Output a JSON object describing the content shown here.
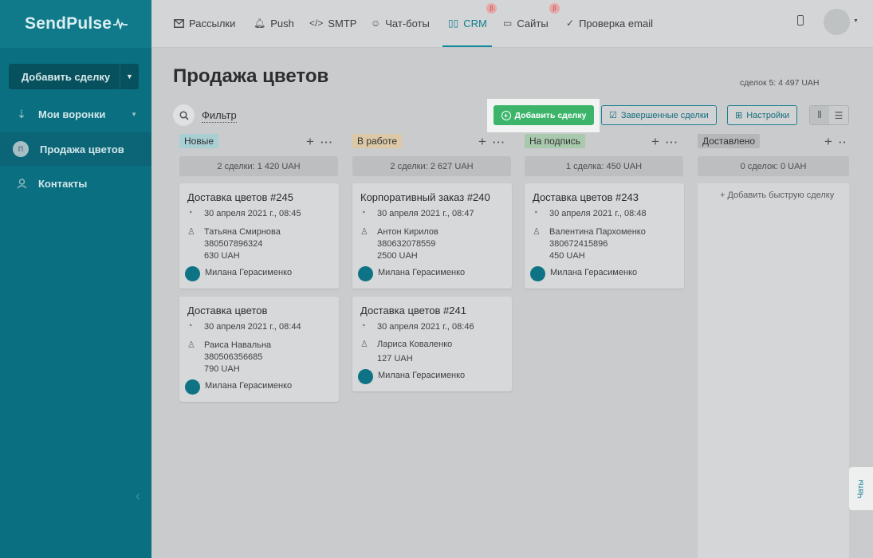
{
  "app": {
    "logo": "SendPulse"
  },
  "sidebar": {
    "add_deal": "Добавить сделку",
    "items": [
      {
        "label": "Мои воронки",
        "icon": "funnel-icon"
      },
      {
        "label": "Продажа цветов",
        "icon": "avatar",
        "initial": "П"
      },
      {
        "label": "Контакты",
        "icon": "contacts-icon"
      }
    ]
  },
  "topnav": {
    "items": [
      {
        "label": "Рассылки",
        "icon": "mail-icon"
      },
      {
        "label": "Push",
        "icon": "bell-icon"
      },
      {
        "label": "SMTP",
        "icon": "code-icon"
      },
      {
        "label": "Чат-боты",
        "icon": "chatbot-icon"
      },
      {
        "label": "CRM",
        "icon": "crm-icon",
        "beta": "β"
      },
      {
        "label": "Сайты",
        "icon": "site-icon",
        "beta": "β"
      },
      {
        "label": "Проверка email",
        "icon": "check-icon"
      }
    ]
  },
  "main": {
    "title": "Продажа цветов",
    "total": "сделок 5: 4 497 UAH",
    "filter": "Фильтр",
    "add_deal_button": "Добавить сделку",
    "completed_button": "Завершенные сделки",
    "settings_button": "Настройки"
  },
  "columns": [
    {
      "name": "Новые",
      "color": "#a8cfd3",
      "summary": "2 сделки: 1 420 UAH"
    },
    {
      "name": "В работе",
      "color": "#dcc8a6",
      "summary": "2 сделки: 2 627 UAH"
    },
    {
      "name": "На подпись",
      "color": "#a9c9ad",
      "summary": "1 сделка: 450 UAH"
    },
    {
      "name": "Доставлено",
      "color": "#b5b7b8",
      "summary": "0 сделок: 0 UAH",
      "quick_add": "Добавить быструю сделку"
    }
  ],
  "cards": [
    {
      "title": "Доставка цветов #245",
      "date": "30 апреля 2021 г., 08:45",
      "contact": "Татьяна Смирнова",
      "phone": "380507896324",
      "amount": "630 UAH",
      "manager": "Милана Герасименко"
    },
    {
      "title": "Доставка цветов",
      "date": "30 апреля 2021 г., 08:44",
      "contact": "Раиса Навальна",
      "phone": "380506356685",
      "amount": "790 UAH",
      "manager": "Милана Герасименко"
    },
    {
      "title": "Корпоративный заказ #240",
      "date": "30 апреля 2021 г., 08:47",
      "contact": "Антон Кирилов",
      "phone": "380632078559",
      "amount": "2500 UAH",
      "manager": "Милана Герасименко"
    },
    {
      "title": "Доставка цветов #241",
      "date": "30 апреля 2021 г., 08:46",
      "contact": "Лариса Коваленко",
      "amount": "127 UAH",
      "manager": "Милана Герасименко"
    },
    {
      "title": "Доставка цветов #243",
      "date": "30 апреля 2021 г., 08:48",
      "contact": "Валентина Пархоменко",
      "phone": "380672415896",
      "amount": "450 UAH",
      "manager": "Милана Герасименко"
    }
  ],
  "chats_tab": "Чаты"
}
